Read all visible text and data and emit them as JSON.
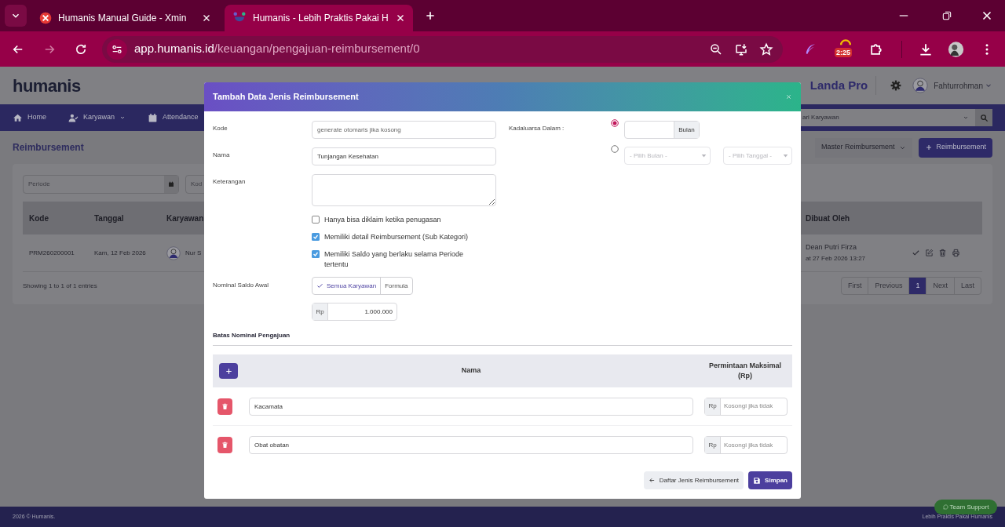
{
  "browser": {
    "tabs": [
      {
        "title": "Humanis Manual Guide - Xmin",
        "selected": false
      },
      {
        "title": "Humanis - Lebih Praktis Pakai H",
        "selected": true
      }
    ],
    "url": {
      "host": "app.humanis.id",
      "path": "/keuangan/pengajuan-reimbursement/0"
    },
    "extension_badge": "2:25"
  },
  "app": {
    "logo": "humanis",
    "company": "Landa Pro",
    "user": "Fahturrohman",
    "nav": [
      {
        "label": "Home",
        "kind": "home",
        "dropdown": false
      },
      {
        "label": "Karyawan",
        "kind": "user",
        "dropdown": true
      },
      {
        "label": "Attendance",
        "kind": "calendar",
        "dropdown": false
      }
    ],
    "search": {
      "placeholder": "ari Karyawan"
    },
    "page_title": "Reimbursement",
    "buttons": [
      {
        "label": "Master Reimbursement",
        "kind": "dropdown"
      },
      {
        "label": "Reimbursement",
        "kind": "add"
      }
    ],
    "filters": [
      {
        "placeholder": "Periode"
      },
      {
        "placeholder": "Kod"
      }
    ],
    "table": {
      "columns": [
        "Kode",
        "Tanggal",
        "Karyawan",
        "Dibuat Oleh"
      ],
      "rows": [
        {
          "kode": "PRM260200001",
          "tanggal": "Kam, 12 Feb 2026",
          "karyawan": "Nur S",
          "dibuat_oleh": "Dean Putri Firza",
          "dibuat_at": "at 27 Feb 2026 13:27"
        }
      ]
    },
    "entries": "Showing 1 to 1 of 1 entries",
    "pagination": [
      {
        "label": "First",
        "selected": false,
        "disabled": true
      },
      {
        "label": "Previous",
        "selected": false,
        "disabled": true
      },
      {
        "label": "1",
        "selected": true,
        "disabled": false
      },
      {
        "label": "Next",
        "selected": false,
        "disabled": true
      },
      {
        "label": "Last",
        "selected": false,
        "disabled": true
      }
    ],
    "footer": {
      "left": "2026 © Humanis.",
      "right": "Lebih Praktis Pakai Humanis",
      "support": "Team Support"
    }
  },
  "modal": {
    "title": "Tambah Data Jenis Reimbursement",
    "fields": [
      {
        "label": "Kode",
        "kind": "input",
        "placeholder": "generate otomaris jika kosong"
      },
      {
        "label": "Nama",
        "kind": "input",
        "value": "Tunjangan Kesehatan"
      },
      {
        "label": "Keterangan",
        "kind": "textarea"
      }
    ],
    "checkboxes": [
      {
        "label": "Hanya bisa diklaim ketika penugasan",
        "checked": false
      },
      {
        "label": "Memiliki detail Reimbursement (Sub Kategori)",
        "checked": true
      },
      {
        "label": "Memiliki Saldo yang berlaku selama Periode tertentu",
        "checked": true
      }
    ],
    "saldo": {
      "label": "Nominal Saldo Awal",
      "modes": [
        {
          "label": "Semua Karyawan",
          "selected": true
        },
        {
          "label": "Formula",
          "selected": false
        }
      ],
      "prefix": "Rp",
      "value": "1.000.000"
    },
    "expiry": {
      "label": "Kadaluarsa Dalam :",
      "options": [
        {
          "kind": "months",
          "selected": true,
          "unit": "Bulan"
        },
        {
          "kind": "date",
          "selected": false,
          "selects": [
            "- Pilih Bulan -",
            "- Pilih Tanggal -"
          ]
        }
      ]
    },
    "limits": {
      "title": "Batas Nominal Pengajuan",
      "columns": [
        "Nama",
        "Permintaan Maksimal (Rp)"
      ],
      "items": [
        {
          "name": "Kacamata",
          "prefix": "Rp",
          "placeholder": "Kosongi jika tidak"
        },
        {
          "name": "Obat obatan",
          "prefix": "Rp",
          "placeholder": "Kosongi jika tidak"
        }
      ]
    },
    "buttons": [
      {
        "label": "Daftar Jenis Reimbursement",
        "kind": "back"
      },
      {
        "label": "Simpan",
        "kind": "save"
      }
    ]
  }
}
